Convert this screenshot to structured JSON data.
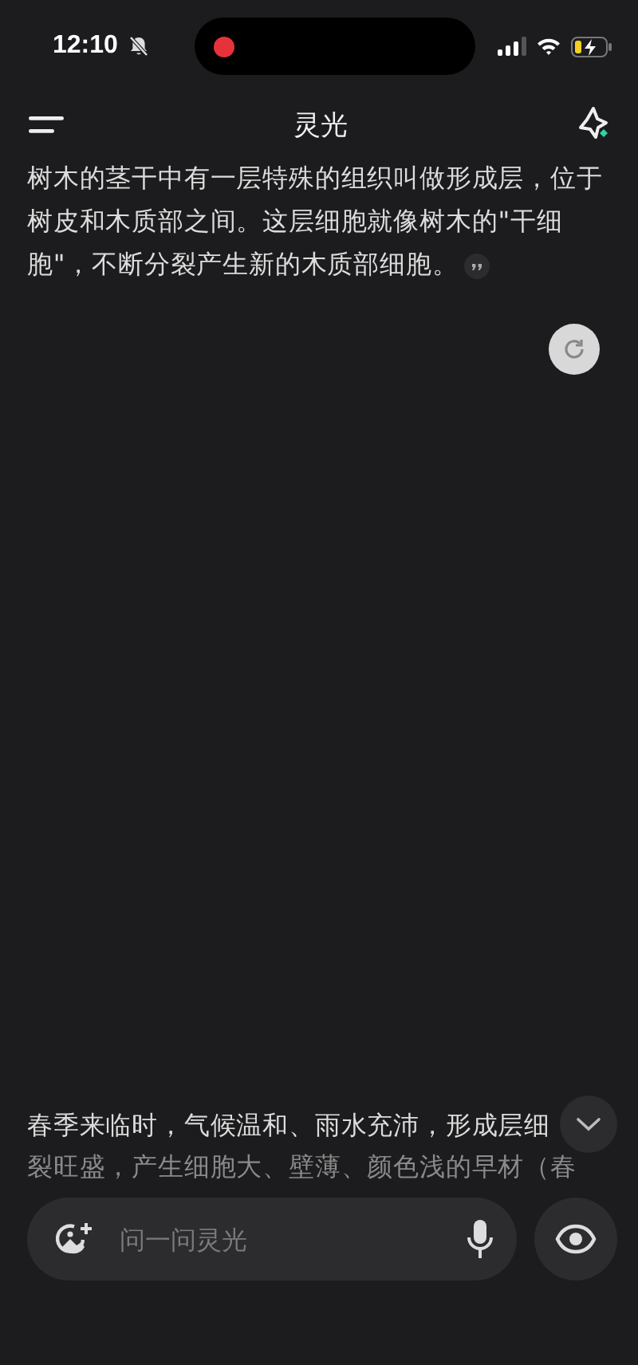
{
  "status_bar": {
    "time": "12:10",
    "silent": true,
    "recording": true,
    "charging": true
  },
  "header": {
    "title": "灵光"
  },
  "answer": {
    "text": "树木的茎干中有一层特殊的组织叫做形成层，位于树皮和木质部之间。这层细胞就像树木的\"干细胞\"，不断分裂产生新的木质部细胞。",
    "has_citation": true
  },
  "next_answer": {
    "lines": [
      "春季来临时，气候温和、雨水充沛，形成层细",
      "裂旺盛，产生细胞大、壁薄、颜色浅的早材（春"
    ]
  },
  "input": {
    "placeholder": "问一问灵光"
  }
}
